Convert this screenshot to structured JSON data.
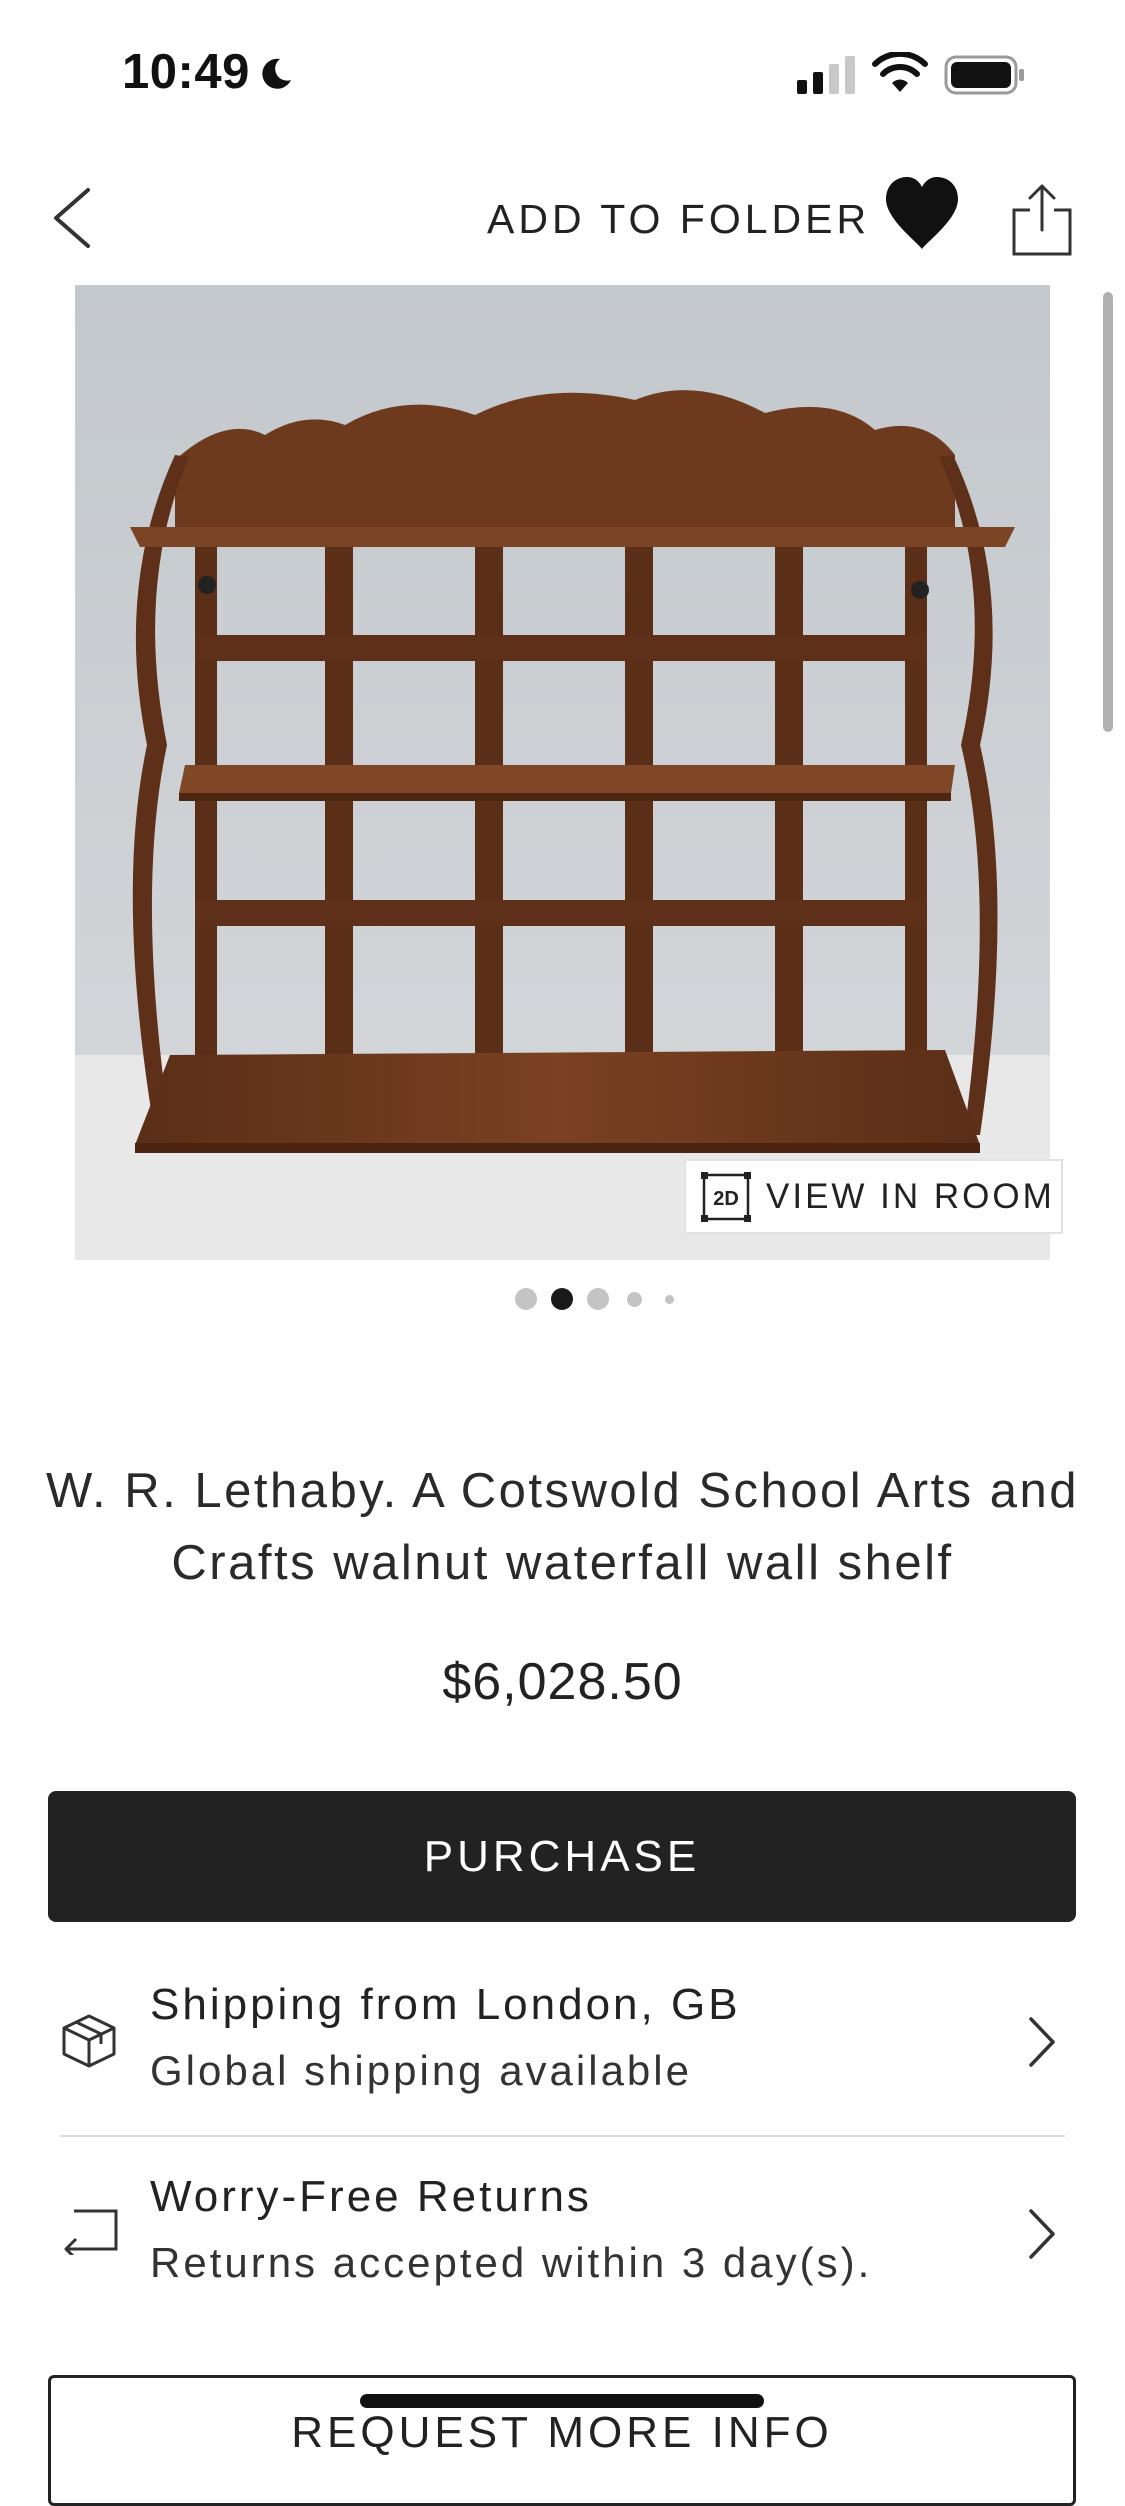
{
  "status_bar": {
    "time": "10:49",
    "icons": [
      "moon-icon",
      "cellular-signal-icon",
      "wifi-icon",
      "battery-icon"
    ]
  },
  "toolbar": {
    "back_icon": "chevron-left-icon",
    "add_to_folder_label": "ADD TO FOLDER",
    "favorite_icon": "heart-filled-icon",
    "share_icon": "share-icon"
  },
  "gallery": {
    "image_subject": "walnut waterfall wall shelf",
    "view_in_room_badge": "2D",
    "view_in_room_label": "VIEW IN ROOM",
    "page_count": 5,
    "active_page": 2
  },
  "product": {
    "title": "W. R. Lethaby. A Cotswold School Arts and Crafts walnut waterfall wall shelf",
    "price": "$6,028.50"
  },
  "actions": {
    "purchase_label": "PURCHASE",
    "request_info_label": "REQUEST MORE INFO"
  },
  "info_rows": [
    {
      "icon": "package-icon",
      "title": "Shipping from London, GB",
      "subtitle": "Global shipping available"
    },
    {
      "icon": "return-arrow-icon",
      "title": "Worry-Free Returns",
      "subtitle": "Returns accepted within 3 day(s)."
    }
  ],
  "colors": {
    "primary_button": "#222222",
    "page_background": "#ffffff",
    "active_dot": "#1a1a1a",
    "inactive_dot": "#c4c4c4"
  }
}
